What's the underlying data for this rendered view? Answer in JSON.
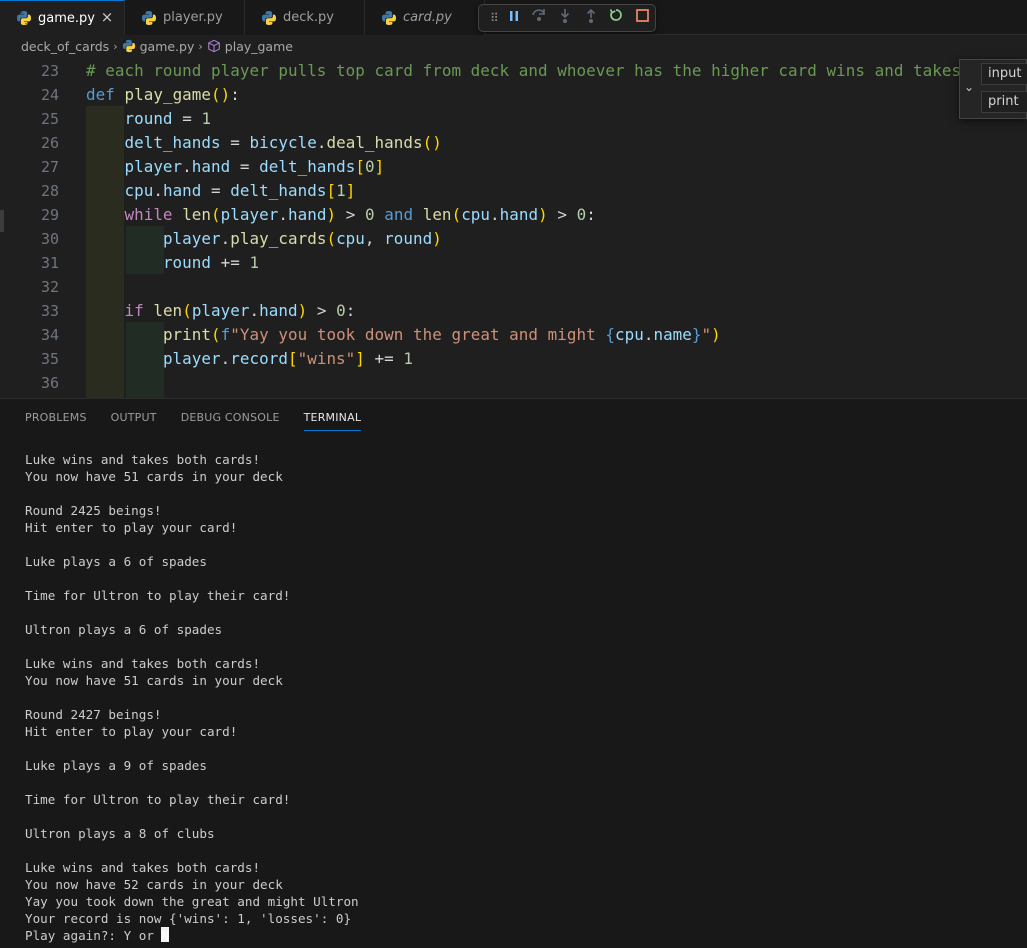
{
  "tabs": [
    {
      "label": "game.py",
      "active": true,
      "italic": false,
      "close": "×"
    },
    {
      "label": "player.py",
      "active": false,
      "italic": false
    },
    {
      "label": "deck.py",
      "active": false,
      "italic": false
    },
    {
      "label": "card.py",
      "active": false,
      "italic": true
    }
  ],
  "debug_toolbar": [
    "grip-icon",
    "pause-icon",
    "step-over-icon",
    "step-into-icon",
    "step-out-icon",
    "restart-icon",
    "stop-icon"
  ],
  "breadcrumb": {
    "folder": "deck_of_cards",
    "file": "game.py",
    "symbol": "play_game"
  },
  "editor": {
    "line_numbers": [
      "23",
      "24",
      "25",
      "26",
      "27",
      "28",
      "29",
      "30",
      "31",
      "32",
      "33",
      "34",
      "35",
      "36"
    ]
  },
  "suggest": {
    "items": [
      "input",
      "print"
    ]
  },
  "panel": {
    "tabs": [
      "PROBLEMS",
      "OUTPUT",
      "DEBUG CONSOLE",
      "TERMINAL"
    ],
    "terminal_lines": [
      "Luke wins and takes both cards!",
      "You now have 51 cards in your deck",
      "",
      "Round 2425 beings!",
      "Hit enter to play your card!",
      "",
      "Luke plays a 6 of spades",
      "",
      "Time for Ultron to play their card!",
      "",
      "Ultron plays a 6 of spades",
      "",
      "Luke wins and takes both cards!",
      "You now have 51 cards in your deck",
      "",
      "Round 2427 beings!",
      "Hit enter to play your card!",
      "",
      "Luke plays a 9 of spades",
      "",
      "Time for Ultron to play their card!",
      "",
      "Ultron plays a 8 of clubs",
      "",
      "Luke wins and takes both cards!",
      "You now have 52 cards in your deck",
      "Yay you took down the great and might Ultron",
      "Your record is now {'wins': 1, 'losses': 0}"
    ],
    "prompt": "Play again?: Y or N"
  },
  "colors": {
    "accent": "#0078d4",
    "comment": "#6a9955",
    "keyword": "#569cd6",
    "control": "#c586c0",
    "function": "#dcdcaa",
    "variable": "#9cdcfe",
    "string": "#ce9178",
    "number": "#b5cea8"
  }
}
